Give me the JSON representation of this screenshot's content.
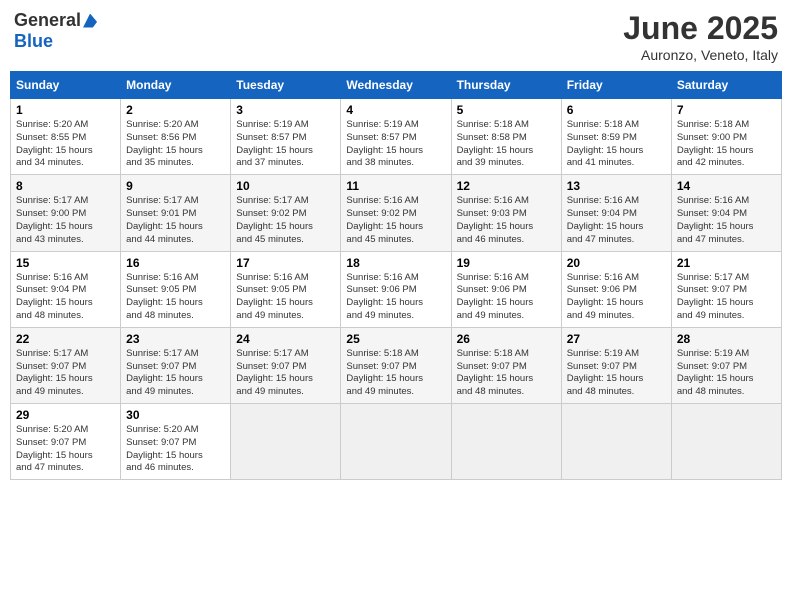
{
  "header": {
    "logo_general": "General",
    "logo_blue": "Blue",
    "month": "June 2025",
    "location": "Auronzo, Veneto, Italy"
  },
  "weekdays": [
    "Sunday",
    "Monday",
    "Tuesday",
    "Wednesday",
    "Thursday",
    "Friday",
    "Saturday"
  ],
  "weeks": [
    [
      {
        "day": 1,
        "info": "Sunrise: 5:20 AM\nSunset: 8:55 PM\nDaylight: 15 hours\nand 34 minutes."
      },
      {
        "day": 2,
        "info": "Sunrise: 5:20 AM\nSunset: 8:56 PM\nDaylight: 15 hours\nand 35 minutes."
      },
      {
        "day": 3,
        "info": "Sunrise: 5:19 AM\nSunset: 8:57 PM\nDaylight: 15 hours\nand 37 minutes."
      },
      {
        "day": 4,
        "info": "Sunrise: 5:19 AM\nSunset: 8:57 PM\nDaylight: 15 hours\nand 38 minutes."
      },
      {
        "day": 5,
        "info": "Sunrise: 5:18 AM\nSunset: 8:58 PM\nDaylight: 15 hours\nand 39 minutes."
      },
      {
        "day": 6,
        "info": "Sunrise: 5:18 AM\nSunset: 8:59 PM\nDaylight: 15 hours\nand 41 minutes."
      },
      {
        "day": 7,
        "info": "Sunrise: 5:18 AM\nSunset: 9:00 PM\nDaylight: 15 hours\nand 42 minutes."
      }
    ],
    [
      {
        "day": 8,
        "info": "Sunrise: 5:17 AM\nSunset: 9:00 PM\nDaylight: 15 hours\nand 43 minutes."
      },
      {
        "day": 9,
        "info": "Sunrise: 5:17 AM\nSunset: 9:01 PM\nDaylight: 15 hours\nand 44 minutes."
      },
      {
        "day": 10,
        "info": "Sunrise: 5:17 AM\nSunset: 9:02 PM\nDaylight: 15 hours\nand 45 minutes."
      },
      {
        "day": 11,
        "info": "Sunrise: 5:16 AM\nSunset: 9:02 PM\nDaylight: 15 hours\nand 45 minutes."
      },
      {
        "day": 12,
        "info": "Sunrise: 5:16 AM\nSunset: 9:03 PM\nDaylight: 15 hours\nand 46 minutes."
      },
      {
        "day": 13,
        "info": "Sunrise: 5:16 AM\nSunset: 9:04 PM\nDaylight: 15 hours\nand 47 minutes."
      },
      {
        "day": 14,
        "info": "Sunrise: 5:16 AM\nSunset: 9:04 PM\nDaylight: 15 hours\nand 47 minutes."
      }
    ],
    [
      {
        "day": 15,
        "info": "Sunrise: 5:16 AM\nSunset: 9:04 PM\nDaylight: 15 hours\nand 48 minutes."
      },
      {
        "day": 16,
        "info": "Sunrise: 5:16 AM\nSunset: 9:05 PM\nDaylight: 15 hours\nand 48 minutes."
      },
      {
        "day": 17,
        "info": "Sunrise: 5:16 AM\nSunset: 9:05 PM\nDaylight: 15 hours\nand 49 minutes."
      },
      {
        "day": 18,
        "info": "Sunrise: 5:16 AM\nSunset: 9:06 PM\nDaylight: 15 hours\nand 49 minutes."
      },
      {
        "day": 19,
        "info": "Sunrise: 5:16 AM\nSunset: 9:06 PM\nDaylight: 15 hours\nand 49 minutes."
      },
      {
        "day": 20,
        "info": "Sunrise: 5:16 AM\nSunset: 9:06 PM\nDaylight: 15 hours\nand 49 minutes."
      },
      {
        "day": 21,
        "info": "Sunrise: 5:17 AM\nSunset: 9:07 PM\nDaylight: 15 hours\nand 49 minutes."
      }
    ],
    [
      {
        "day": 22,
        "info": "Sunrise: 5:17 AM\nSunset: 9:07 PM\nDaylight: 15 hours\nand 49 minutes."
      },
      {
        "day": 23,
        "info": "Sunrise: 5:17 AM\nSunset: 9:07 PM\nDaylight: 15 hours\nand 49 minutes."
      },
      {
        "day": 24,
        "info": "Sunrise: 5:17 AM\nSunset: 9:07 PM\nDaylight: 15 hours\nand 49 minutes."
      },
      {
        "day": 25,
        "info": "Sunrise: 5:18 AM\nSunset: 9:07 PM\nDaylight: 15 hours\nand 49 minutes."
      },
      {
        "day": 26,
        "info": "Sunrise: 5:18 AM\nSunset: 9:07 PM\nDaylight: 15 hours\nand 48 minutes."
      },
      {
        "day": 27,
        "info": "Sunrise: 5:19 AM\nSunset: 9:07 PM\nDaylight: 15 hours\nand 48 minutes."
      },
      {
        "day": 28,
        "info": "Sunrise: 5:19 AM\nSunset: 9:07 PM\nDaylight: 15 hours\nand 48 minutes."
      }
    ],
    [
      {
        "day": 29,
        "info": "Sunrise: 5:20 AM\nSunset: 9:07 PM\nDaylight: 15 hours\nand 47 minutes."
      },
      {
        "day": 30,
        "info": "Sunrise: 5:20 AM\nSunset: 9:07 PM\nDaylight: 15 hours\nand 46 minutes."
      },
      null,
      null,
      null,
      null,
      null
    ]
  ]
}
